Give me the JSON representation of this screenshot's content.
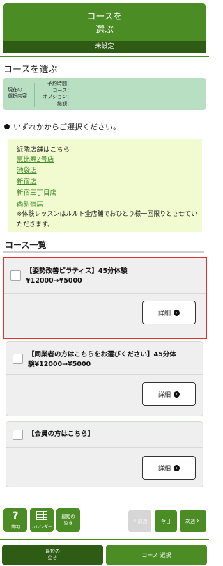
{
  "header": {
    "title_line1": "コースを",
    "title_line2": "選ぶ",
    "status": "未設定"
  },
  "section_title": "コースを選ぶ",
  "selection": {
    "label_line1": "現在の",
    "label_line2": "選択内容",
    "fields": [
      "予約時間：",
      "コース：",
      "オプション：",
      "総額："
    ]
  },
  "instruction": "いずれかからご選択ください。",
  "notice": {
    "heading": "近隣店舗はこちら",
    "stores": [
      "恵比寿2号店",
      "池袋店",
      "新宿店",
      "新宿三丁目店",
      "西新宿店"
    ],
    "note": "※体験レッスンはルルト全店舗でおひとり様一回限りとさせていただきます。"
  },
  "course_list_title": "コース一覧",
  "courses": [
    {
      "title_line1": "【姿勢改善ピラティス】45分体験",
      "title_line2": "¥12000→¥5000",
      "detail_label": "詳細",
      "selected": true
    },
    {
      "title_line1": "【同業者の方はこちらをお選びください】45分体",
      "title_line2": "験¥12000→¥5000",
      "detail_label": "詳細",
      "selected": false
    },
    {
      "title_line1": "【会員の方はこちら】",
      "title_line2": "",
      "detail_label": "詳細",
      "selected": false
    }
  ],
  "toolbar": {
    "help_glyph": "?",
    "help_label": "説明",
    "calendar_label": "カレンダー",
    "shortest_line1": "最短の",
    "shortest_line2": "空き",
    "prev_label": "前週",
    "today_label": "今日",
    "next_label": "次週"
  },
  "footer": {
    "left_line1": "最短の",
    "left_line2": "空き",
    "right_label": "コース 選択"
  },
  "colors": {
    "primary_green": "#4b8c25",
    "dark_green": "#2e5c14",
    "link_green": "#3a8a2a",
    "selected_border": "#e2322f"
  }
}
